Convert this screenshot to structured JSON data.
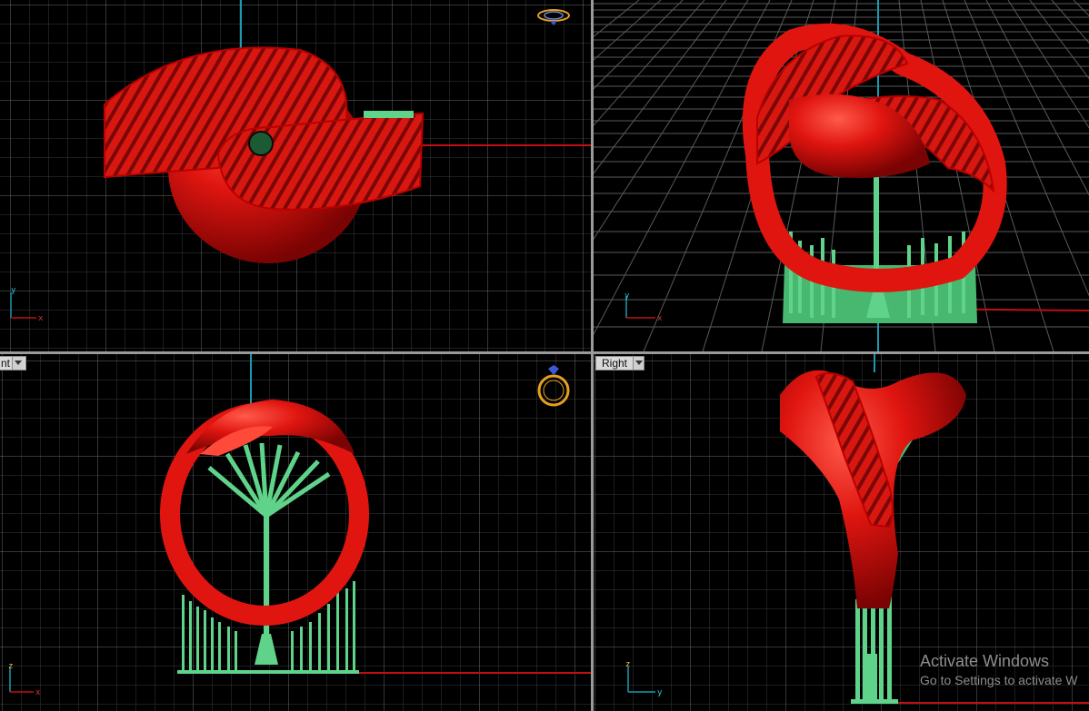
{
  "viewports": {
    "top": {
      "label": "",
      "axis_h": "x",
      "axis_v": "y"
    },
    "perspective": {
      "label": "",
      "axis_h": "x",
      "axis_v": "y"
    },
    "front": {
      "label": "nt",
      "axis_h": "x",
      "axis_v": "z"
    },
    "right": {
      "label": "Right",
      "axis_h": "y",
      "axis_v": "z"
    }
  },
  "watermark": {
    "title": "Activate Windows",
    "subtitle": "Go to Settings to activate W"
  },
  "icons": {
    "top_gizmo": "ring-top-view-icon",
    "front_gizmo": "ring-front-view-icon",
    "dropdown": "chevron-down-icon"
  },
  "colors": {
    "background": "#000000",
    "grid": "#4a4a4a",
    "axis_x": "#c01010",
    "axis_y": "#1a9ab0",
    "model": "#e0201a",
    "supports": "#5fd38a",
    "divider": "#9a9a9a",
    "gizmo": "#e6a020"
  }
}
